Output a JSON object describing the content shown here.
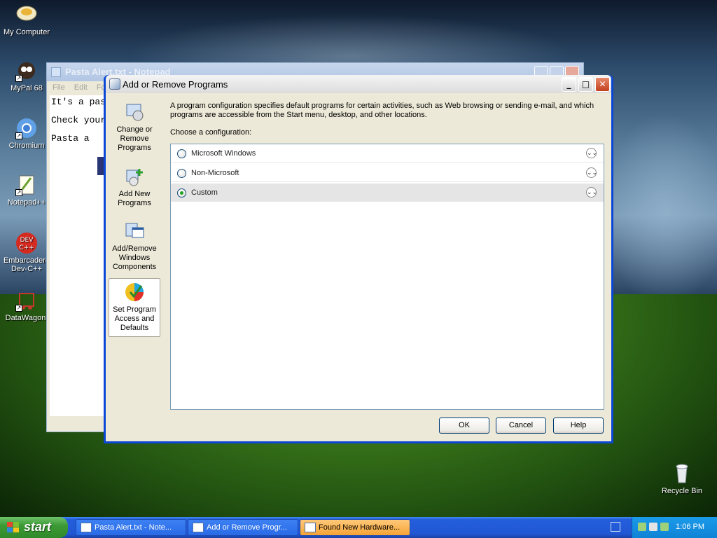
{
  "desktop_icons": [
    {
      "label": "My Computer"
    },
    {
      "label": "MyPal 68"
    },
    {
      "label": "Chromium"
    },
    {
      "label": "Notepad++"
    },
    {
      "label": "Embarcadero Dev-C++"
    },
    {
      "label": "DataWagon."
    },
    {
      "label": "Recycle Bin"
    }
  ],
  "notepad": {
    "title": "Pasta Alert.txt - Notepad",
    "menu": [
      "File",
      "Edit",
      "Fo"
    ],
    "lines": [
      "It's a pas",
      "Check your",
      "Pasta a"
    ]
  },
  "dialog": {
    "title": "Add or Remove Programs",
    "sidebar": [
      {
        "label": "Change or Remove Programs",
        "icon": "change-remove-icon"
      },
      {
        "label": "Add New Programs",
        "icon": "add-new-programs-icon"
      },
      {
        "label": "Add/Remove Windows Components",
        "icon": "windows-components-icon"
      },
      {
        "label": "Set Program Access and Defaults",
        "icon": "program-access-icon"
      }
    ],
    "intro": "A program configuration specifies default programs for certain activities, such as Web browsing or sending e-mail, and which programs are accessible from the Start menu, desktop, and other locations.",
    "choose_label": "Choose a configuration:",
    "options": [
      {
        "label": "Microsoft Windows",
        "selected": false
      },
      {
        "label": "Non-Microsoft",
        "selected": false
      },
      {
        "label": "Custom",
        "selected": true
      }
    ],
    "buttons": {
      "ok": "OK",
      "cancel": "Cancel",
      "help": "Help"
    }
  },
  "taskbar": {
    "start": "start",
    "tasks": [
      {
        "label": "Pasta Alert.txt - Note..."
      },
      {
        "label": "Add or Remove Progr..."
      },
      {
        "label": "Found New Hardware..."
      }
    ],
    "clock": "1:06 PM"
  },
  "colors": {
    "taskbar_blue": "#245edb",
    "start_green": "#3c9a35",
    "dialog_frame": "#0a47d6",
    "highlight_task": "#f5a334"
  }
}
